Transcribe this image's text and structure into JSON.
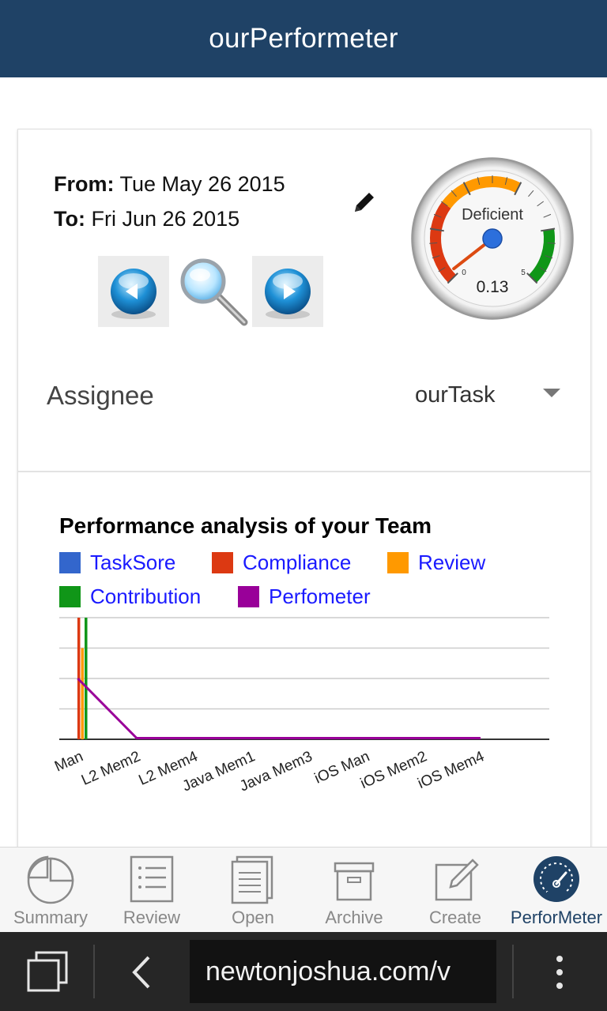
{
  "app": {
    "title": "ourPerformeter"
  },
  "dates": {
    "from_label": "From:",
    "from_value": "Tue May 26 2015",
    "to_label": "To:",
    "to_value": "Fri Jun 26 2015"
  },
  "gauge": {
    "label": "Deficient",
    "value": "0.13",
    "min": "0",
    "max": "5",
    "value_numeric": 0.13
  },
  "assignee": {
    "label": "Assignee",
    "value": "ourTask"
  },
  "chart_data": {
    "type": "bar",
    "title": "Performance analysis of your Team",
    "categories": [
      "Man",
      "L2 Mem2",
      "L2 Mem4",
      "Java Mem1",
      "Java Mem3",
      "iOS Man",
      "iOS Mem2",
      "iOS Mem4"
    ],
    "series": [
      {
        "name": "TaskSore",
        "color": "#3366cc",
        "values": [
          0,
          0,
          0,
          0,
          0,
          0,
          0,
          0
        ]
      },
      {
        "name": "Compliance",
        "color": "#dc3912",
        "values": [
          4,
          0,
          0,
          0,
          0,
          0,
          0,
          0
        ]
      },
      {
        "name": "Review",
        "color": "#ff9900",
        "values": [
          3,
          0,
          0,
          0,
          0,
          0,
          0,
          0
        ]
      },
      {
        "name": "Contribution",
        "color": "#109618",
        "values": [
          4,
          0,
          0,
          0,
          0,
          0,
          0,
          0
        ]
      },
      {
        "name": "Perfometer",
        "color": "#990099",
        "type": "line",
        "values": [
          2,
          0,
          0,
          0,
          0,
          0,
          0,
          0
        ]
      }
    ],
    "ylim": [
      0,
      4
    ],
    "grid": true,
    "legend": "top"
  },
  "tabs": [
    {
      "label": "Summary",
      "icon": "pie-chart-icon"
    },
    {
      "label": "Review",
      "icon": "list-icon"
    },
    {
      "label": "Open",
      "icon": "document-icon"
    },
    {
      "label": "Archive",
      "icon": "archive-box-icon"
    },
    {
      "label": "Create",
      "icon": "edit-square-icon"
    },
    {
      "label": "PerforMeter",
      "icon": "speedometer-icon",
      "active": true
    }
  ],
  "browser": {
    "url": "newtonjoshua.com/v"
  }
}
